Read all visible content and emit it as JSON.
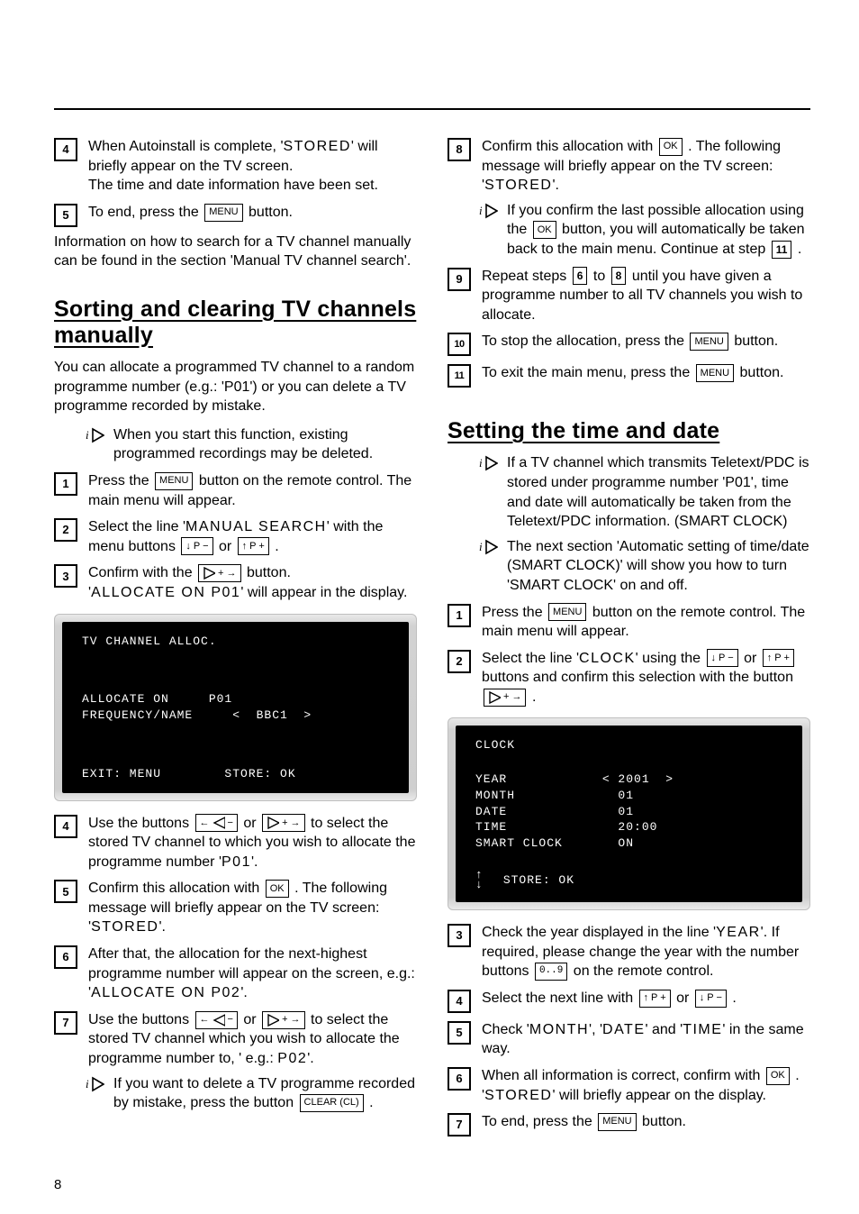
{
  "page_number": "8",
  "left": {
    "pre_steps": [
      {
        "n": "4",
        "text_a": "When Autoinstall is complete, '",
        "code_a": "STORED",
        "text_b": "' will briefly appear on the TV screen.",
        "text_c": "The time and date information have been set."
      },
      {
        "n": "5",
        "text_a": "To end, press the ",
        "key": "MENU",
        "text_b": " button."
      }
    ],
    "pre_para": "Information on how to search for a TV channel manually can be found in the section 'Manual TV channel search'.",
    "h2": "Sorting and clearing TV channels manually",
    "intro": "You can allocate a programmed TV channel to a random programme number (e.g.: 'P01') or you can delete a TV programme recorded by mistake.",
    "tip1": "When you start this function, existing programmed recordings may be deleted.",
    "steps": {
      "s1_a": "Press the ",
      "s1_key": "MENU",
      "s1_b": " button on the remote control. The main menu will appear.",
      "s2_a": "Select the line '",
      "s2_code": "MANUAL SEARCH",
      "s2_b": "' with the menu buttons ",
      "s2_k1_label": "P −",
      "s2_mid": " or ",
      "s2_k2_label": "P +",
      "s2_end": " .",
      "s3_a": "Confirm with the ",
      "s3_b": " button.",
      "s3_c": "'",
      "s3_code": "ALLOCATE ON P01",
      "s3_d": "' will appear in the display.",
      "s4_a": "Use the buttons ",
      "s4_mid": " or ",
      "s4_b": " to select the stored TV channel to which you wish to allocate the programme number '",
      "s4_code": "P01",
      "s4_c": "'.",
      "s5_a": "Confirm this allocation with ",
      "s5_key": "OK",
      "s5_b": " . The following message will briefly appear on the TV screen: '",
      "s5_code": "STORED",
      "s5_c": "'.",
      "s6_a": "After that, the allocation for the next-highest programme number will appear on the screen, e.g.: '",
      "s6_code": "ALLOCATE ON P02",
      "s6_b": "'.",
      "s7_a": "Use the buttons ",
      "s7_mid": " or ",
      "s7_b": " to select the stored TV channel which you wish to allocate the programme number to, ' e.g.: ",
      "s7_code": "P02",
      "s7_c": "'.",
      "s7_tip_a": "If you want to delete a TV programme recorded by mistake, press the button ",
      "s7_tip_key": "CLEAR (CL)",
      "s7_tip_b": " ."
    },
    "osd1": {
      "title": "TV CHANNEL ALLOC.",
      "rows": "ALLOCATE ON     P01\nFREQUENCY/NAME     <  BBC1  >",
      "footer": "EXIT: MENU        STORE: OK"
    }
  },
  "right": {
    "cont_steps": {
      "s8_a": "Confirm this allocation with ",
      "s8_key": "OK",
      "s8_b": " . The following message will briefly appear on the TV screen: '",
      "s8_code": "STORED",
      "s8_c": "'.",
      "s8_tip_a": "If you confirm the last possible allocation using the ",
      "s8_tip_key": "OK",
      "s8_tip_b": " button, you will automatically be taken back to the main menu. Continue at step ",
      "s8_tip_ref": "11",
      "s8_tip_c": "  .",
      "s9_a": "Repeat steps ",
      "s9_ref1": "6",
      "s9_mid": " to ",
      "s9_ref2": "8",
      "s9_b": " until  you have given a programme number to all TV channels you wish to allocate.",
      "s10_a": "To stop the allocation, press the ",
      "s10_key": "MENU",
      "s10_b": " button.",
      "s11_a": "To exit the main menu, press the ",
      "s11_key": "MENU",
      "s11_b": " button."
    },
    "h2": "Setting the time and date",
    "tipA": "If a TV channel which transmits Teletext/PDC is stored under programme number 'P01', time and date will automatically be taken from the Teletext/PDC information. (SMART CLOCK)",
    "tipB": "The next section 'Automatic setting of time/date (SMART CLOCK)' will show you how to turn 'SMART CLOCK' on and off.",
    "steps": {
      "s1_a": "Press the ",
      "s1_key": "MENU",
      "s1_b": " button on the remote control. The main menu will appear.",
      "s2_a": "Select the line '",
      "s2_code": "CLOCK",
      "s2_b": "' using the ",
      "s2_k1": "P −",
      "s2_mid": " or ",
      "s2_k2": "P +",
      "s2_c": " buttons and confirm this selection with the button ",
      "s2_end": " .",
      "s3_a": "Check the year displayed in the line '",
      "s3_code": "YEAR",
      "s3_b": "'. If required, please change the year with the number buttons ",
      "s3_key": "0..9",
      "s3_c": " on the remote control.",
      "s4_a": "Select the next line with ",
      "s4_k1": "P +",
      "s4_mid": " or ",
      "s4_k2": "P −",
      "s4_b": " .",
      "s5_a": "Check '",
      "s5_code1": "MONTH",
      "s5_b": "', '",
      "s5_code2": "DATE",
      "s5_c": "' and '",
      "s5_code3": "TIME",
      "s5_d": "' in the same way.",
      "s6_a": "When all information is correct, confirm with ",
      "s6_key": "OK",
      "s6_b": " . '",
      "s6_code": "STORED",
      "s6_c": "' will briefly appear on the display.",
      "s7_a": "To end, press the ",
      "s7_key": "MENU",
      "s7_b": " button."
    },
    "osd2": {
      "title": "CLOCK",
      "rows": "YEAR            < 2001  >\nMONTH             01\nDATE              01\nTIME              20:00\nSMART CLOCK       ON",
      "footer": "STORE: OK"
    }
  }
}
